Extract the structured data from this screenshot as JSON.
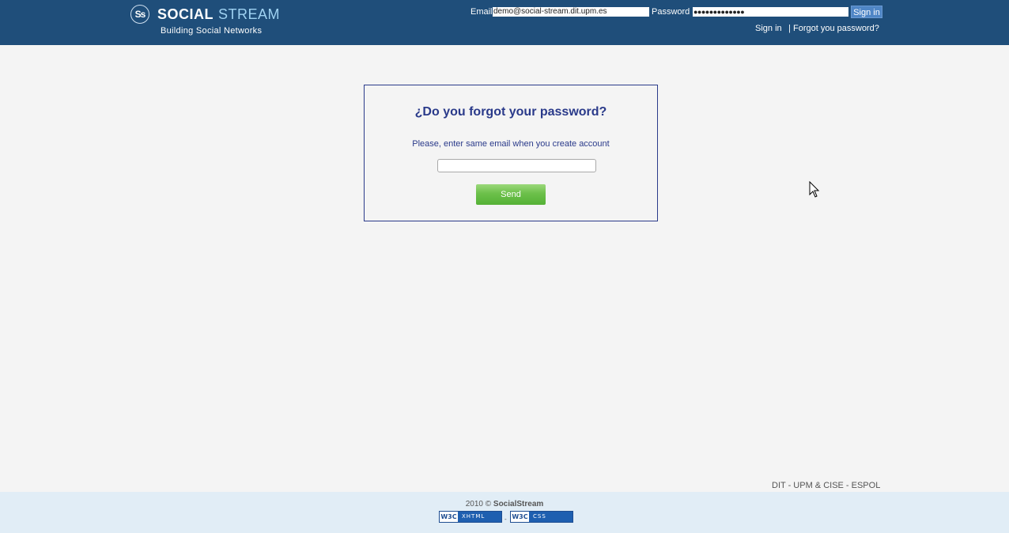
{
  "header": {
    "logo_mark": "Ss",
    "logo_social": "SOCIAL",
    "logo_stream": "STREAM",
    "tagline": "Building Social Networks",
    "email_label": "Email",
    "email_value": "demo@social-stream.dit.upm.es",
    "password_label": "Password",
    "password_value": "●●●●●●●●●●●●●",
    "signin_button": "Sign in",
    "signin_link": "Sign in",
    "separator": "|",
    "forgot_link": "Forgot you password?"
  },
  "box": {
    "title": "¿Do you forgot your password?",
    "subtitle": "Please, enter same email when you create account",
    "email_value": "",
    "send_button": "Send"
  },
  "footer": {
    "credit": "DIT - UPM & CISE - ESPOL",
    "year": "2010 ©",
    "brand": "SocialStream",
    "badge_w3c": "W3C",
    "badge_xhtml": "XHTML",
    "badge_separator": "-",
    "badge_css": "CSS"
  },
  "colors": {
    "header_bg": "#1f4e7a",
    "accent": "#2a3a8a",
    "send_green": "#6cc04a",
    "footer_bg": "#e1edf6"
  }
}
